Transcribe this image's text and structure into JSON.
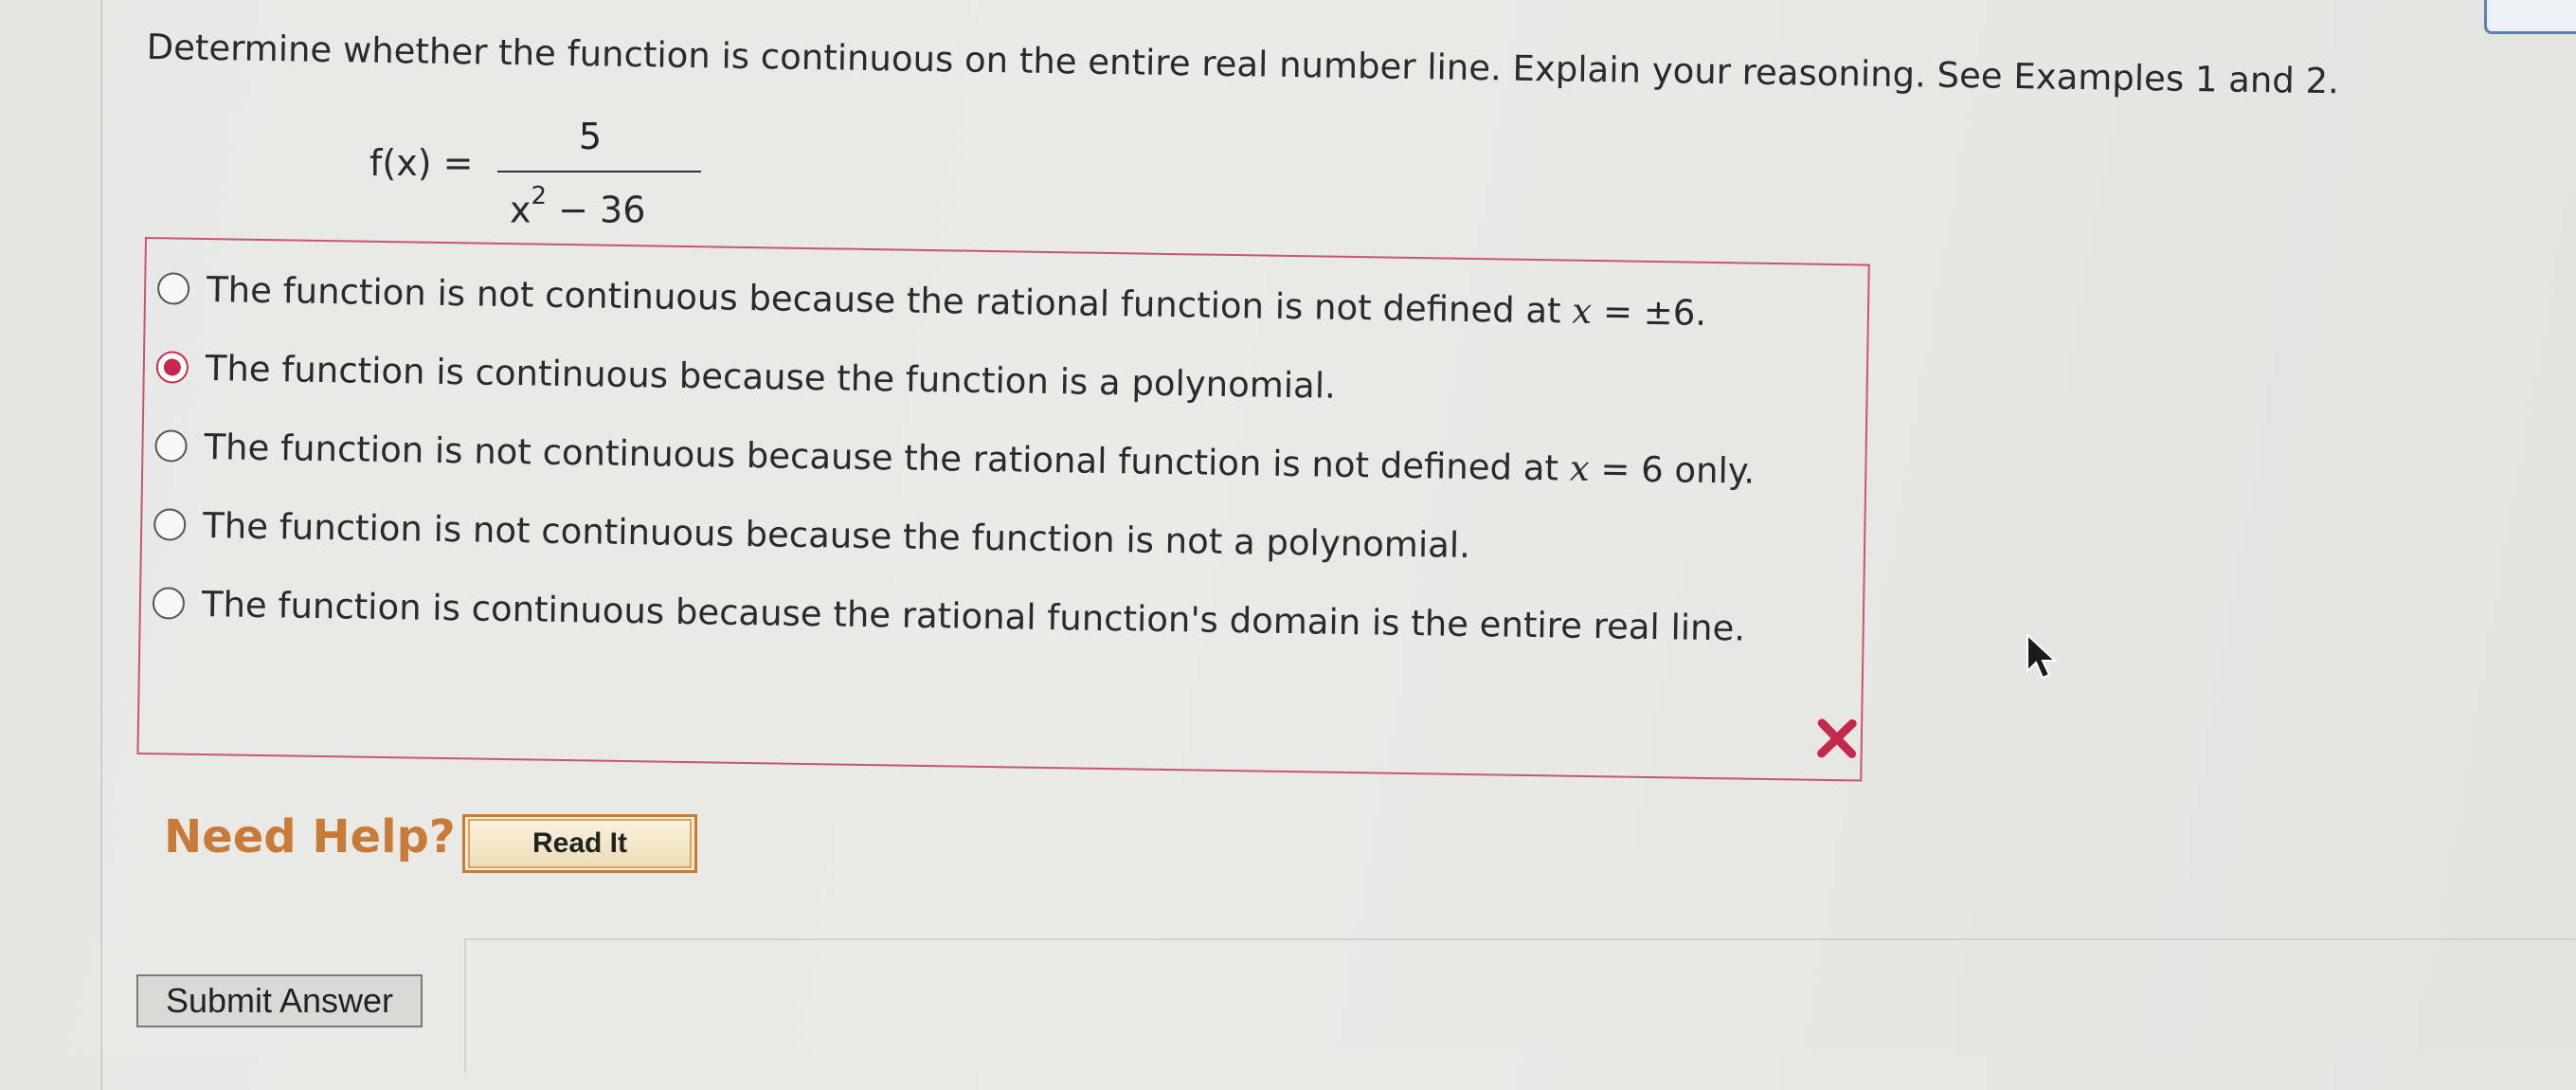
{
  "question": {
    "text": "Determine whether the function is continuous on the entire real number line. Explain your reasoning. See Examples 1 and 2."
  },
  "formula": {
    "lhs": "f(x) =",
    "numerator": "5",
    "denominator_base": "x",
    "denominator_exp": "2",
    "denominator_rest": " − 36"
  },
  "options": [
    {
      "pre": "The function is not continuous because the rational function is not defined at ",
      "var": "x",
      "post": " = ±6.",
      "selected": false
    },
    {
      "pre": "The function is continuous because the function is a polynomial.",
      "var": "",
      "post": "",
      "selected": true
    },
    {
      "pre": "The function is not continuous because the rational function is not defined at ",
      "var": "x",
      "post": " = 6 only.",
      "selected": false
    },
    {
      "pre": "The function is not continuous because the function is not a polynomial.",
      "var": "",
      "post": "",
      "selected": false
    },
    {
      "pre": "The function is continuous because the rational function's domain is the entire real line.",
      "var": "",
      "post": "",
      "selected": false
    }
  ],
  "result_icon": "incorrect-x-icon",
  "colors": {
    "error": "#c4284a",
    "help": "#c87a38",
    "box_border": "#c9566b"
  },
  "help": {
    "label": "Need Help?",
    "read_it_label": "Read It"
  },
  "submit": {
    "label": "Submit Answer"
  }
}
